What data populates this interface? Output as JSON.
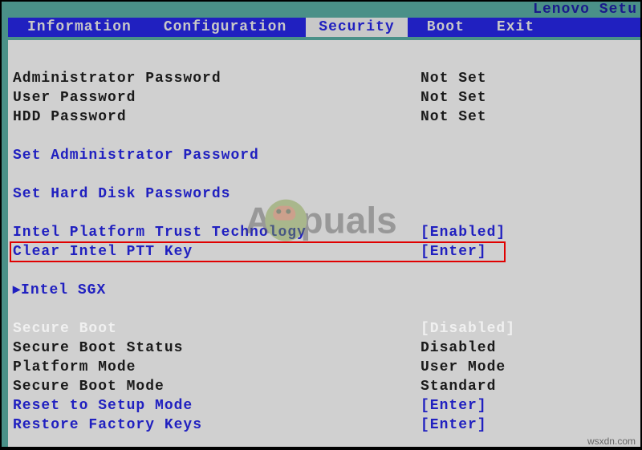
{
  "title": "Lenovo Setu",
  "menu": {
    "items": [
      {
        "label": "Information",
        "selected": false
      },
      {
        "label": "Configuration",
        "selected": false
      },
      {
        "label": "Security",
        "selected": true
      },
      {
        "label": "Boot",
        "selected": false
      },
      {
        "label": "Exit",
        "selected": false
      }
    ]
  },
  "rows": {
    "admin_pw_label": "Administrator Password",
    "admin_pw_value": "Not Set",
    "user_pw_label": "User Password",
    "user_pw_value": "Not Set",
    "hdd_pw_label": "HDD Password",
    "hdd_pw_value": "Not Set",
    "set_admin_pw": "Set Administrator Password",
    "set_hdd_pw": "Set Hard Disk Passwords",
    "intel_ptt_label": "Intel Platform Trust Technology",
    "intel_ptt_value": "[Enabled]",
    "clear_ptt_label": "Clear Intel PTT Key",
    "clear_ptt_value": "[Enter]",
    "intel_sgx": "Intel SGX",
    "secure_boot_label": "Secure Boot",
    "secure_boot_value": "[Disabled]",
    "secure_boot_status_label": "Secure Boot Status",
    "secure_boot_status_value": "Disabled",
    "platform_mode_label": "Platform Mode",
    "platform_mode_value": "User Mode",
    "secure_boot_mode_label": "Secure Boot Mode",
    "secure_boot_mode_value": "Standard",
    "reset_setup_label": "Reset to Setup Mode",
    "reset_setup_value": "[Enter]",
    "restore_keys_label": "Restore Factory Keys",
    "restore_keys_value": "[Enter]"
  },
  "watermark": {
    "left": "A",
    "right": "puals"
  },
  "source": "wsxdn.com",
  "arrow": "▸"
}
